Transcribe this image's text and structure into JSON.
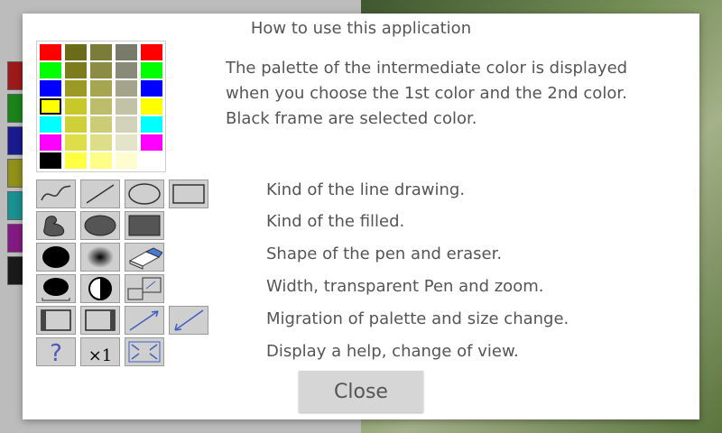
{
  "dialog": {
    "title": "How to use this application",
    "description_lines": [
      "The palette of the intermediate color is displayed",
      "when you choose the 1st color and the 2nd color.",
      "Black frame are selected color."
    ],
    "help_lines": [
      "Kind of the line drawing.",
      "Kind of the filled.",
      "Shape of the pen and eraser.",
      "Width, transparent Pen and zoom.",
      "Migration of palette and size change.",
      "Display a help, change of view."
    ],
    "close_label": "Close"
  },
  "palette": {
    "columns": [
      [
        "#ff0000",
        "#00ff00",
        "#0000ff",
        "#ffff00",
        "#00ffff",
        "#ff00ff",
        "#000000"
      ],
      [
        "#6b6b1a",
        "#7c7c1f",
        "#9a9a25",
        "#c8c82a",
        "#cfcf3a",
        "#dede4a",
        "#ffff44"
      ],
      [
        "#7c7c3a",
        "#8c8c44",
        "#a6a650",
        "#bcbc6a",
        "#cccc77",
        "#dede88",
        "#ffff88"
      ],
      [
        "#7a7a6a",
        "#8a8a78",
        "#a4a48c",
        "#c2c2a6",
        "#d2d2ba",
        "#e4e4c8",
        "#fffcd0"
      ],
      [
        "#ff0000",
        "#00ff00",
        "#0000ff",
        "#ffff00",
        "#00ffff",
        "#ff00ff",
        ""
      ]
    ],
    "selected": "#ffff00"
  },
  "background": {
    "swatches": [
      "#c02020",
      "#20a020",
      "#2020b0",
      "#b0b020",
      "#20b0b0",
      "#a020a0",
      "#202020"
    ]
  },
  "tools": [
    {
      "icon": "freehand-line-icon",
      "row": 0
    },
    {
      "icon": "straight-line-icon",
      "row": 0
    },
    {
      "icon": "ellipse-outline-icon",
      "row": 0
    },
    {
      "icon": "rectangle-outline-icon",
      "row": 0
    },
    {
      "icon": "filled-freeform-icon",
      "row": 1
    },
    {
      "icon": "filled-ellipse-icon",
      "row": 1
    },
    {
      "icon": "filled-rectangle-icon",
      "row": 1
    },
    {
      "icon": "round-pen-icon",
      "row": 2
    },
    {
      "icon": "airbrush-pen-icon",
      "row": 2
    },
    {
      "icon": "eraser-icon",
      "row": 2
    },
    {
      "icon": "pen-width-icon",
      "row": 3
    },
    {
      "icon": "transparent-pen-icon",
      "row": 3
    },
    {
      "icon": "zoom-icon",
      "row": 3
    },
    {
      "icon": "palette-left-icon",
      "row": 4
    },
    {
      "icon": "palette-right-icon",
      "row": 4
    },
    {
      "icon": "size-up-icon",
      "row": 4
    },
    {
      "icon": "size-down-icon",
      "row": 4
    },
    {
      "icon": "help-icon",
      "row": 5
    },
    {
      "icon": "view-scale-icon",
      "row": 5,
      "label": "×1"
    },
    {
      "icon": "fullscreen-icon",
      "row": 5
    }
  ]
}
